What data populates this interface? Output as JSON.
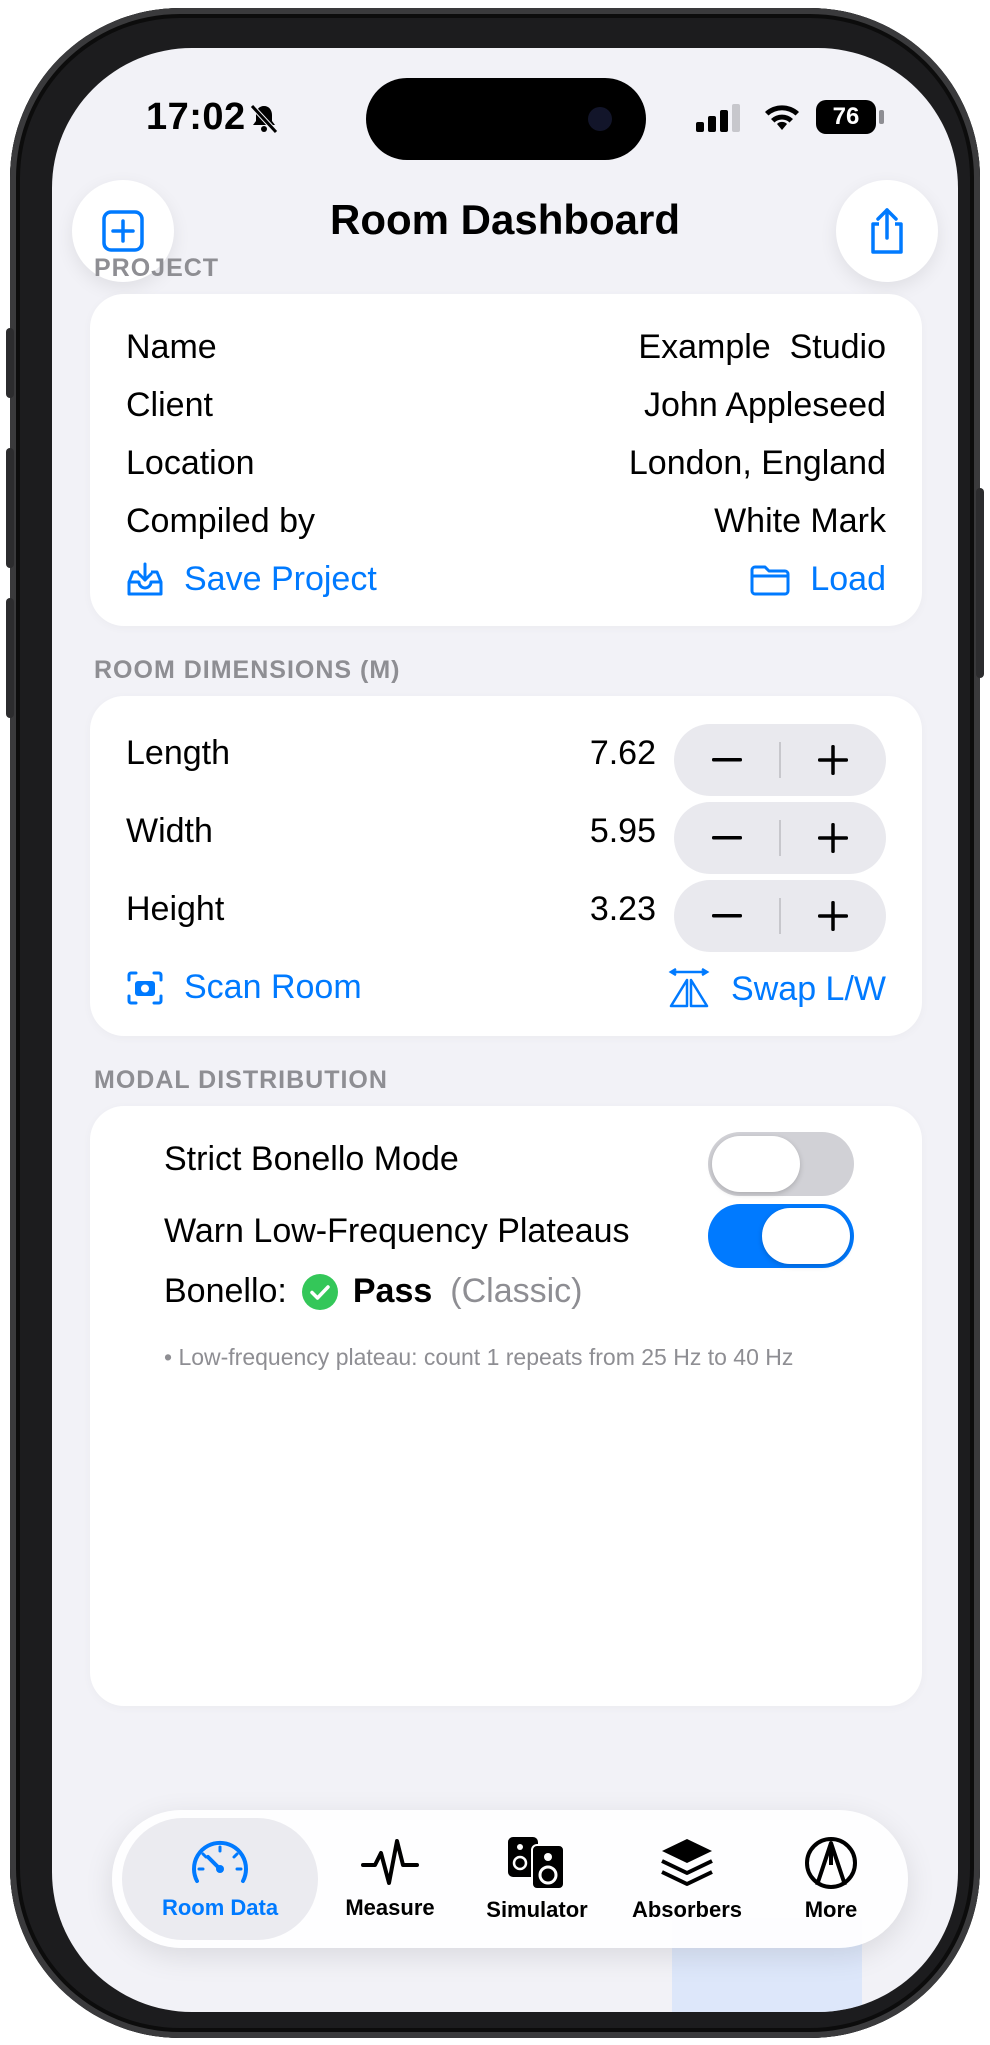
{
  "status_bar": {
    "time": "17:02",
    "battery": "76"
  },
  "header": {
    "title": "Room Dashboard"
  },
  "project": {
    "section_label": "PROJECT",
    "rows": [
      {
        "label": "Name",
        "value": "Example  Studio"
      },
      {
        "label": "Client",
        "value": "John Appleseed"
      },
      {
        "label": "Location",
        "value": "London, England"
      },
      {
        "label": "Compiled by",
        "value": "White Mark"
      }
    ],
    "save_label": "Save Project",
    "load_label": "Load"
  },
  "dimensions": {
    "section_label": "ROOM DIMENSIONS (M)",
    "rows": [
      {
        "label": "Length",
        "value": "7.62"
      },
      {
        "label": "Width",
        "value": "5.95"
      },
      {
        "label": "Height",
        "value": "3.23"
      }
    ],
    "minus": "−",
    "plus": "+",
    "scan_label": "Scan Room",
    "swap_label": "Swap L/W"
  },
  "modal": {
    "section_label": "MODAL DISTRIBUTION",
    "strict_label": "Strict Bonello Mode",
    "strict_on": false,
    "warn_label": "Warn Low-Frequency Plateaus",
    "warn_on": true,
    "bonello_prefix": "Bonello:",
    "bonello_result": "Pass",
    "bonello_mode": "(Classic)",
    "note": "• Low-frequency plateau: count 1 repeats from 25 Hz to 40 Hz"
  },
  "tabs": [
    {
      "label": "Room Data",
      "icon": "gauge-icon",
      "active": true
    },
    {
      "label": "Measure",
      "icon": "waveform-icon",
      "active": false
    },
    {
      "label": "Simulator",
      "icon": "speakers-icon",
      "active": false
    },
    {
      "label": "Absorbers",
      "icon": "layers-icon",
      "active": false
    },
    {
      "label": "More",
      "icon": "tuning-fork-icon",
      "active": false
    }
  ],
  "colors": {
    "accent": "#007aff",
    "success": "#34c759",
    "background": "#f2f2f7"
  }
}
